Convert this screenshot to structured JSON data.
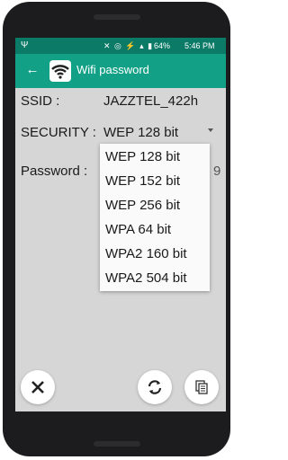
{
  "status_bar": {
    "time": "5:46 PM",
    "battery": "64%",
    "icons": "✕ ◎ ⚡ ▴ ▮"
  },
  "app_bar": {
    "title": "Wifi password",
    "back_icon": "arrow-back-icon",
    "app_icon": "wifi-icon"
  },
  "form": {
    "ssid_label": "SSID :",
    "ssid_value": "JAZZTEL_422h",
    "security_label": "SECURITY :",
    "security_value": "WEP 128 bit",
    "password_label": "Password :",
    "password_partial": "9"
  },
  "security_options": [
    "WEP 128 bit",
    "WEP 152 bit",
    "WEP 256 bit",
    "WPA 64 bit",
    "WPA2 160 bit",
    "WPA2 504 bit"
  ],
  "buttons": {
    "close_icon": "close-icon",
    "refresh_icon": "refresh-icon",
    "copy_icon": "copy-icon"
  },
  "colors": {
    "status": "#0b7a67",
    "appbar": "#12a186",
    "screen": "#d6d6d6"
  }
}
